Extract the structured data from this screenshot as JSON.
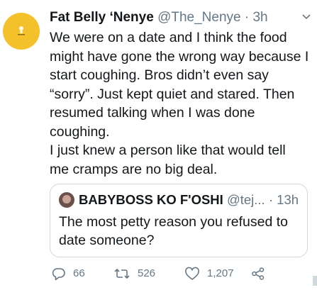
{
  "tweet": {
    "author_name": "Fat Belly ‘Nenye",
    "handle": "@The_Nenye",
    "separator": "·",
    "time": "3h",
    "avatar_icon": "bulb-icon",
    "lines": [
      "We were on a date and I think the food",
      "might have gone the wrong way because I",
      "start coughing. Bros didn’t even say",
      "“sorry”. Just kept quiet and stared. Then",
      "resumed talking when I was done",
      "coughing.",
      "I just knew a person like that would tell",
      "me cramps are no big deal."
    ]
  },
  "quoted": {
    "author_name": "BABYBOSS KO F'OSHI",
    "handle": "@tej...",
    "separator": "·",
    "time": "13h",
    "lines": [
      "The most petty reason you refused to",
      "date someone?"
    ]
  },
  "actions": {
    "replies": "66",
    "retweets": "526",
    "likes": "1,207",
    "icons": [
      "reply-icon",
      "retweet-icon",
      "like-icon",
      "share-icon"
    ]
  },
  "colors": {
    "text": "#14171a",
    "muted": "#657786",
    "border": "#cfd9de",
    "avatar": "#f5c12a"
  }
}
